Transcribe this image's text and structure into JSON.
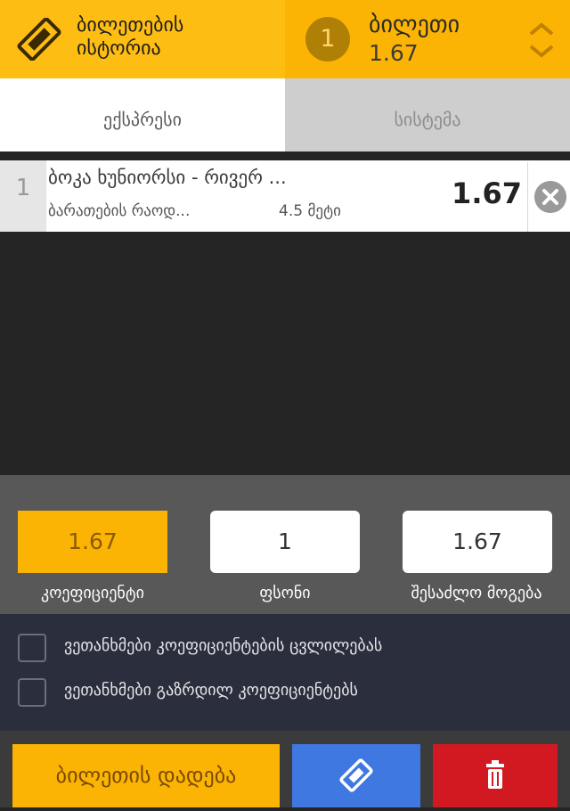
{
  "header": {
    "history_label": "ბილეთების ისტორია",
    "slip_count": "1",
    "slip_title": "ბილეთი",
    "slip_total_odds": "1.67"
  },
  "tabs": [
    {
      "label": "ექსპრესი",
      "active": true
    },
    {
      "label": "სისტემა",
      "active": false
    }
  ],
  "bet": {
    "index": "1",
    "event": "ბოკა ხუნიორსი - რივერ ...",
    "market": "ბარათების რაოდ...",
    "selection": "4.5 მეტი",
    "odds": "1.67"
  },
  "stake_panel": {
    "coefficient_value": "1.67",
    "coefficient_label": "კოეფიციენტი",
    "stake_value": "1",
    "stake_label": "ფსონი",
    "possible_win_value": "1.67",
    "possible_win_label": "შესაძლო მოგება"
  },
  "agreements": [
    {
      "label": "ვეთანხმები კოეფიციენტების ცვლილებას",
      "checked": false
    },
    {
      "label": "ვეთანხმები გაზრდილ კოეფიციენტებს",
      "checked": false
    }
  ],
  "actions": {
    "place_bet_label": "ბილეთის დადება",
    "quick_bet_icon": "ticket-icon",
    "clear_icon": "trash-icon"
  },
  "colors": {
    "accent": "#fbb404",
    "blue": "#3f78e0",
    "red": "#d21820",
    "dark_panel": "#2b2e3d"
  }
}
